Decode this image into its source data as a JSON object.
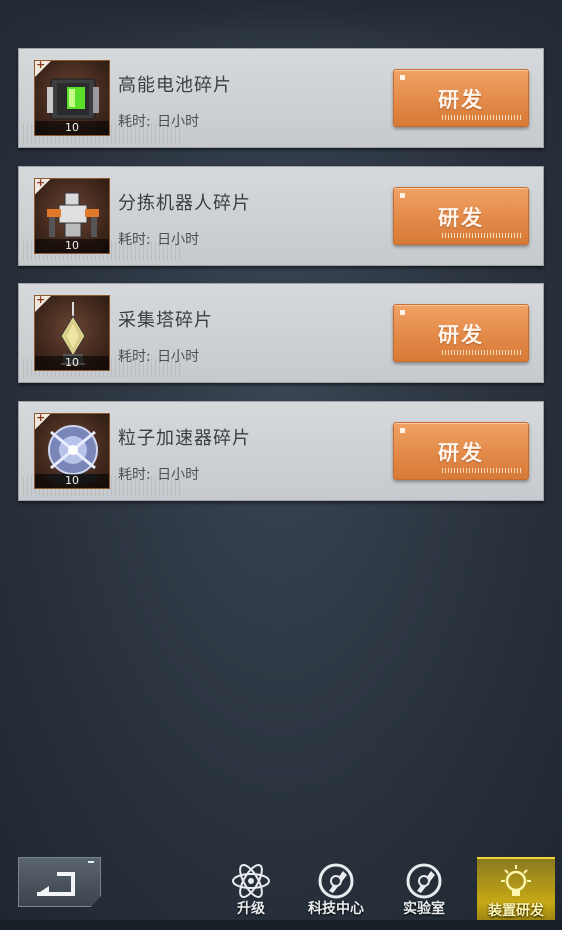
{
  "items": [
    {
      "name": "高能电池碎片",
      "time_label": "耗时:",
      "time_value": "日小时",
      "count": "10",
      "button": "研发",
      "icon": "battery-icon"
    },
    {
      "name": "分拣机器人碎片",
      "time_label": "耗时:",
      "time_value": "日小时",
      "count": "10",
      "button": "研发",
      "icon": "robot-icon"
    },
    {
      "name": "采集塔碎片",
      "time_label": "耗时:",
      "time_value": "日小时",
      "count": "10",
      "button": "研发",
      "icon": "tower-icon"
    },
    {
      "name": "粒子加速器碎片",
      "time_label": "耗时:",
      "time_value": "日小时",
      "count": "10",
      "button": "研发",
      "icon": "accelerator-icon"
    }
  ],
  "nav": {
    "upgrade": "升级",
    "tech_center": "科技中心",
    "lab": "实验室",
    "device_research": "装置研发"
  },
  "colors": {
    "button_orange": "#e38a48",
    "card_bg": "#d0d4d7",
    "active_tab": "#c7a816"
  }
}
